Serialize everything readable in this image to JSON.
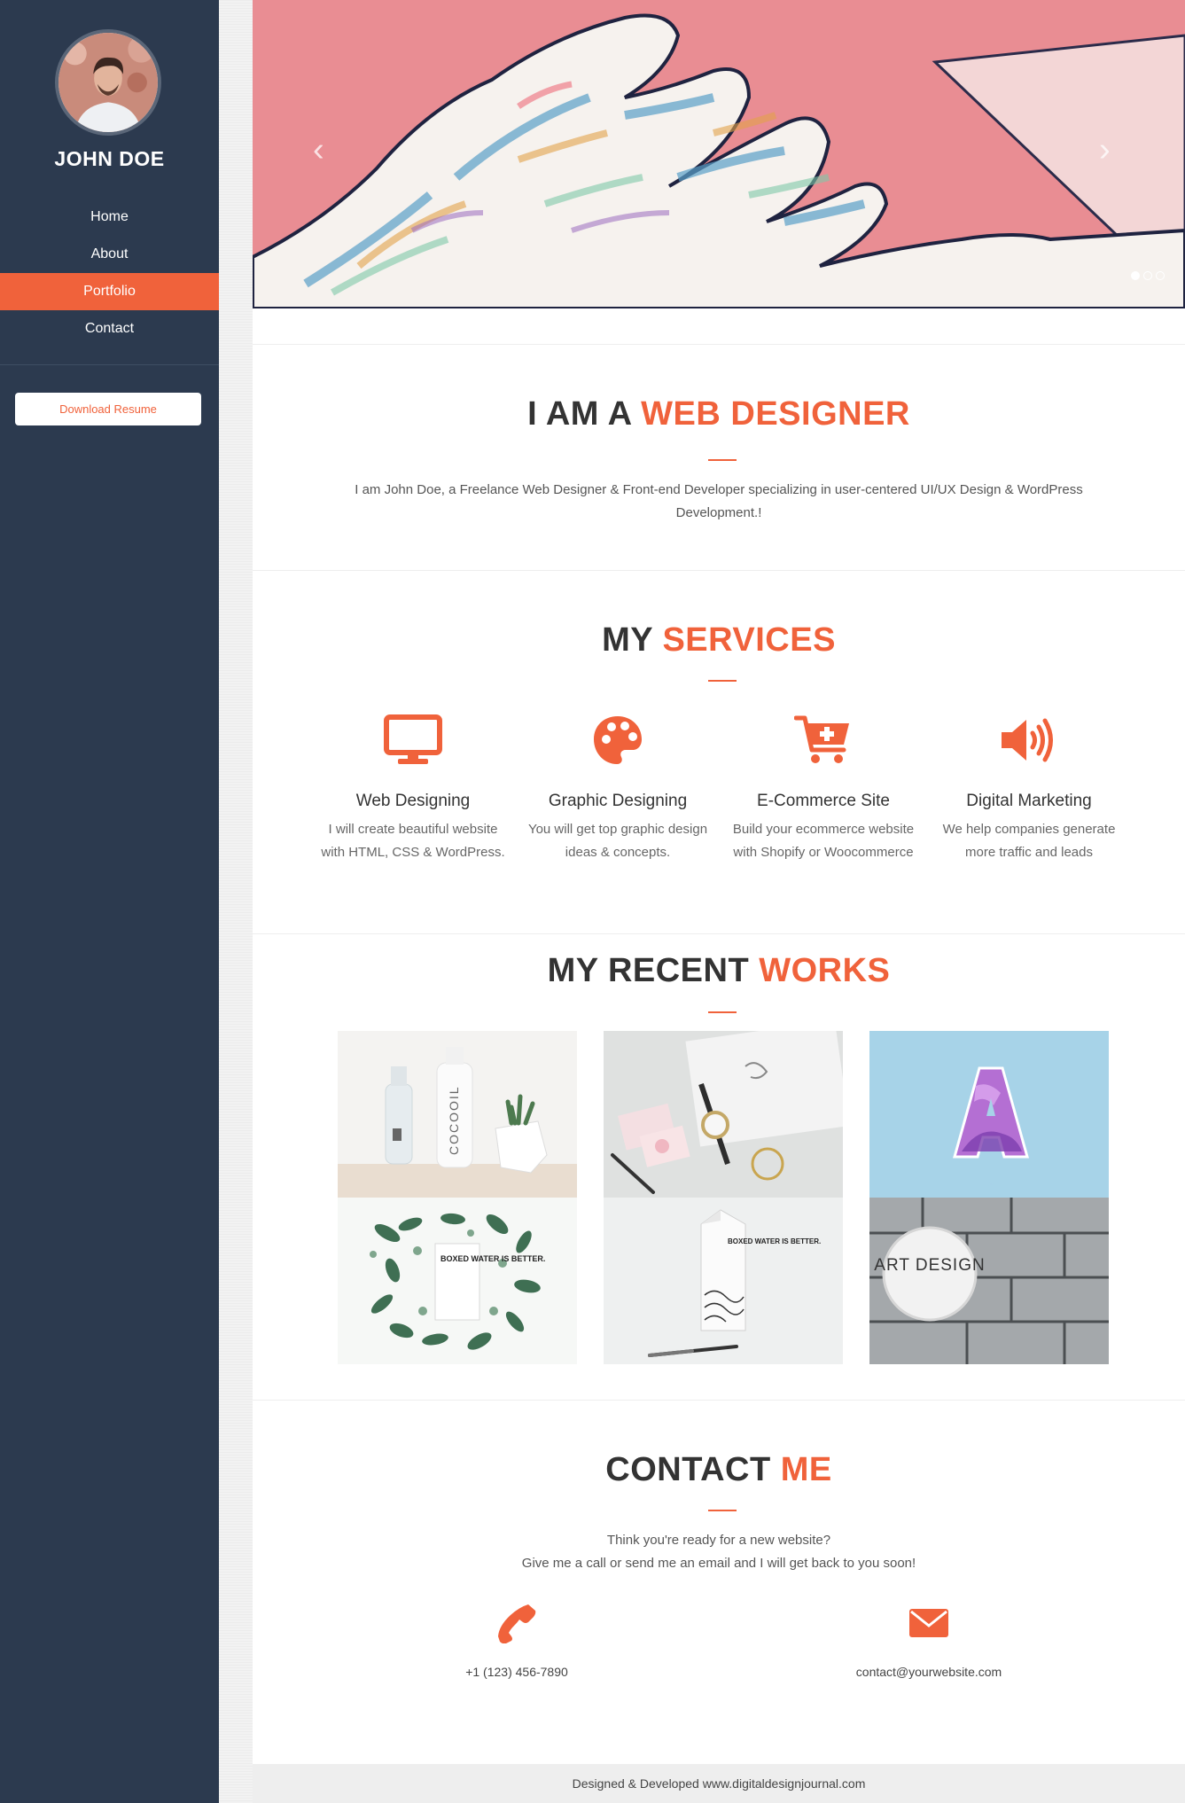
{
  "sidebar": {
    "name": "JOHN DOE",
    "nav": [
      {
        "label": "Home"
      },
      {
        "label": "About"
      },
      {
        "label": "Portfolio",
        "active": true
      },
      {
        "label": "Contact"
      }
    ],
    "resume_button": "Download Resume"
  },
  "hero": {
    "prev_arrow": "‹",
    "next_arrow": "›",
    "slides_total": 3,
    "active_slide": 1
  },
  "intro": {
    "title_plain": "I AM A ",
    "title_highlight": "WEB DESIGNER",
    "text": "I am John Doe, a Freelance Web Designer & Front-end Developer specializing in user-centered UI/UX Design & WordPress Development.!"
  },
  "services": {
    "title_plain": "MY ",
    "title_highlight": "SERVICES",
    "items": [
      {
        "icon": "monitor-icon",
        "title": "Web Designing",
        "text": "I will create beautiful website with HTML, CSS & WordPress."
      },
      {
        "icon": "palette-icon",
        "title": "Graphic Designing",
        "text": "You will get top graphic design ideas & concepts."
      },
      {
        "icon": "cart-icon",
        "title": "E-Commerce Site",
        "text": "Build your ecommerce website with Shopify or Woocommerce"
      },
      {
        "icon": "megaphone-icon",
        "title": "Digital Marketing",
        "text": "We help companies generate more traffic and leads"
      }
    ]
  },
  "works": {
    "title_plain": "MY RECENT ",
    "title_highlight": "WORKS",
    "bottle_label": "COCOOIL",
    "boxed_water_text": "BOXED WATER IS BETTER.",
    "art_design_text": "ART DESIGN",
    "letter_a": "A"
  },
  "contact": {
    "title_plain": "CONTACT ",
    "title_highlight": "ME",
    "line1": "Think you're ready for a new website?",
    "line2": "Give me a call or send me an email and I will get back to you soon!",
    "phone": "+1 (123) 456-7890",
    "email": "contact@yourwebsite.com"
  },
  "footer": {
    "text": "Designed & Developed www.digitaldesignjournal.com"
  },
  "colors": {
    "accent": "#f0623b",
    "sidebar_bg": "#2c3a4f"
  }
}
